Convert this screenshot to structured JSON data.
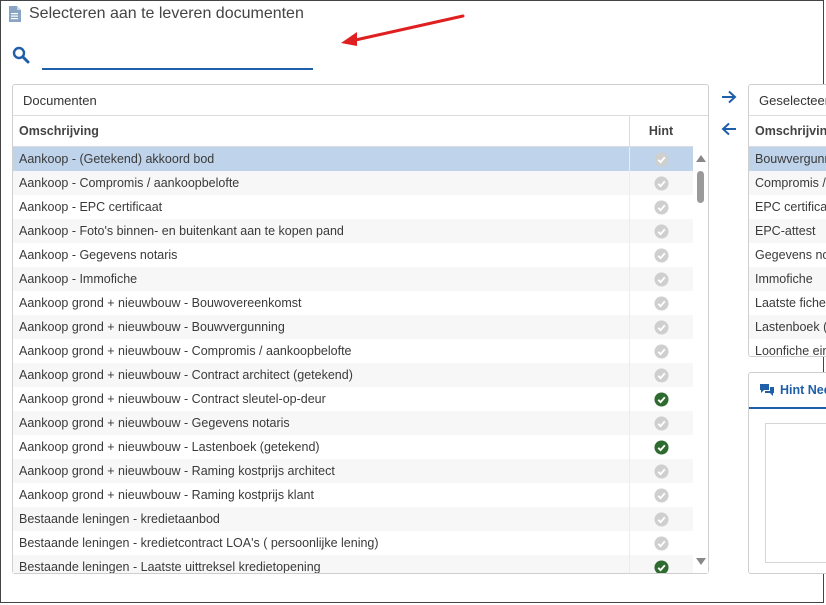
{
  "title": "Selecteren aan te leveren documenten",
  "search": {
    "value": "",
    "placeholder": ""
  },
  "left_panel": {
    "header": "Documenten",
    "col_desc": "Omschrijving",
    "col_hint": "Hint",
    "rows": [
      {
        "label": "Aankoop - (Getekend) akkoord bod",
        "hint": "inactive",
        "selected": true
      },
      {
        "label": "Aankoop - Compromis / aankoopbelofte",
        "hint": "inactive"
      },
      {
        "label": "Aankoop - EPC certificaat",
        "hint": "inactive"
      },
      {
        "label": "Aankoop - Foto's binnen- en buitenkant aan te kopen pand",
        "hint": "inactive"
      },
      {
        "label": "Aankoop - Gegevens notaris",
        "hint": "inactive"
      },
      {
        "label": "Aankoop - Immofiche",
        "hint": "inactive"
      },
      {
        "label": "Aankoop grond + nieuwbouw - Bouwovereenkomst",
        "hint": "inactive"
      },
      {
        "label": "Aankoop grond + nieuwbouw - Bouwvergunning",
        "hint": "inactive"
      },
      {
        "label": "Aankoop grond + nieuwbouw - Compromis / aankoopbelofte",
        "hint": "inactive"
      },
      {
        "label": "Aankoop grond + nieuwbouw - Contract architect (getekend)",
        "hint": "inactive"
      },
      {
        "label": "Aankoop grond + nieuwbouw - Contract sleutel-op-deur",
        "hint": "active"
      },
      {
        "label": "Aankoop grond + nieuwbouw - Gegevens notaris",
        "hint": "inactive"
      },
      {
        "label": "Aankoop grond + nieuwbouw - Lastenboek (getekend)",
        "hint": "active"
      },
      {
        "label": "Aankoop grond + nieuwbouw - Raming kostprijs architect",
        "hint": "inactive"
      },
      {
        "label": "Aankoop grond + nieuwbouw - Raming kostprijs klant",
        "hint": "inactive"
      },
      {
        "label": "Bestaande leningen - kredietaanbod",
        "hint": "inactive"
      },
      {
        "label": "Bestaande leningen - kredietcontract LOA's ( persoonlijke lening)",
        "hint": "inactive"
      },
      {
        "label": "Bestaande leningen - Laatste uittreksel kredietopening",
        "hint": "active"
      }
    ]
  },
  "right_panel": {
    "header": "Geselecteerd",
    "col_desc": "Omschrijving",
    "rows": [
      "Bouwvergunning",
      "Compromis / aankoopbelofte",
      "EPC certificaat",
      "EPC-attest",
      "Gegevens notaris",
      "Immofiche",
      "Laatste fiche",
      "Lastenboek (getekend)",
      "Loonfiche einde jaar"
    ]
  },
  "hint_panel": {
    "tab_label": "Hint Nee"
  },
  "colors": {
    "accent": "#1f5ea8",
    "check_active": "#2e6b2e",
    "check_inactive": "#cfcfcf",
    "selected_row": "#bfd3ea",
    "annotation_arrow": "#e02020"
  }
}
